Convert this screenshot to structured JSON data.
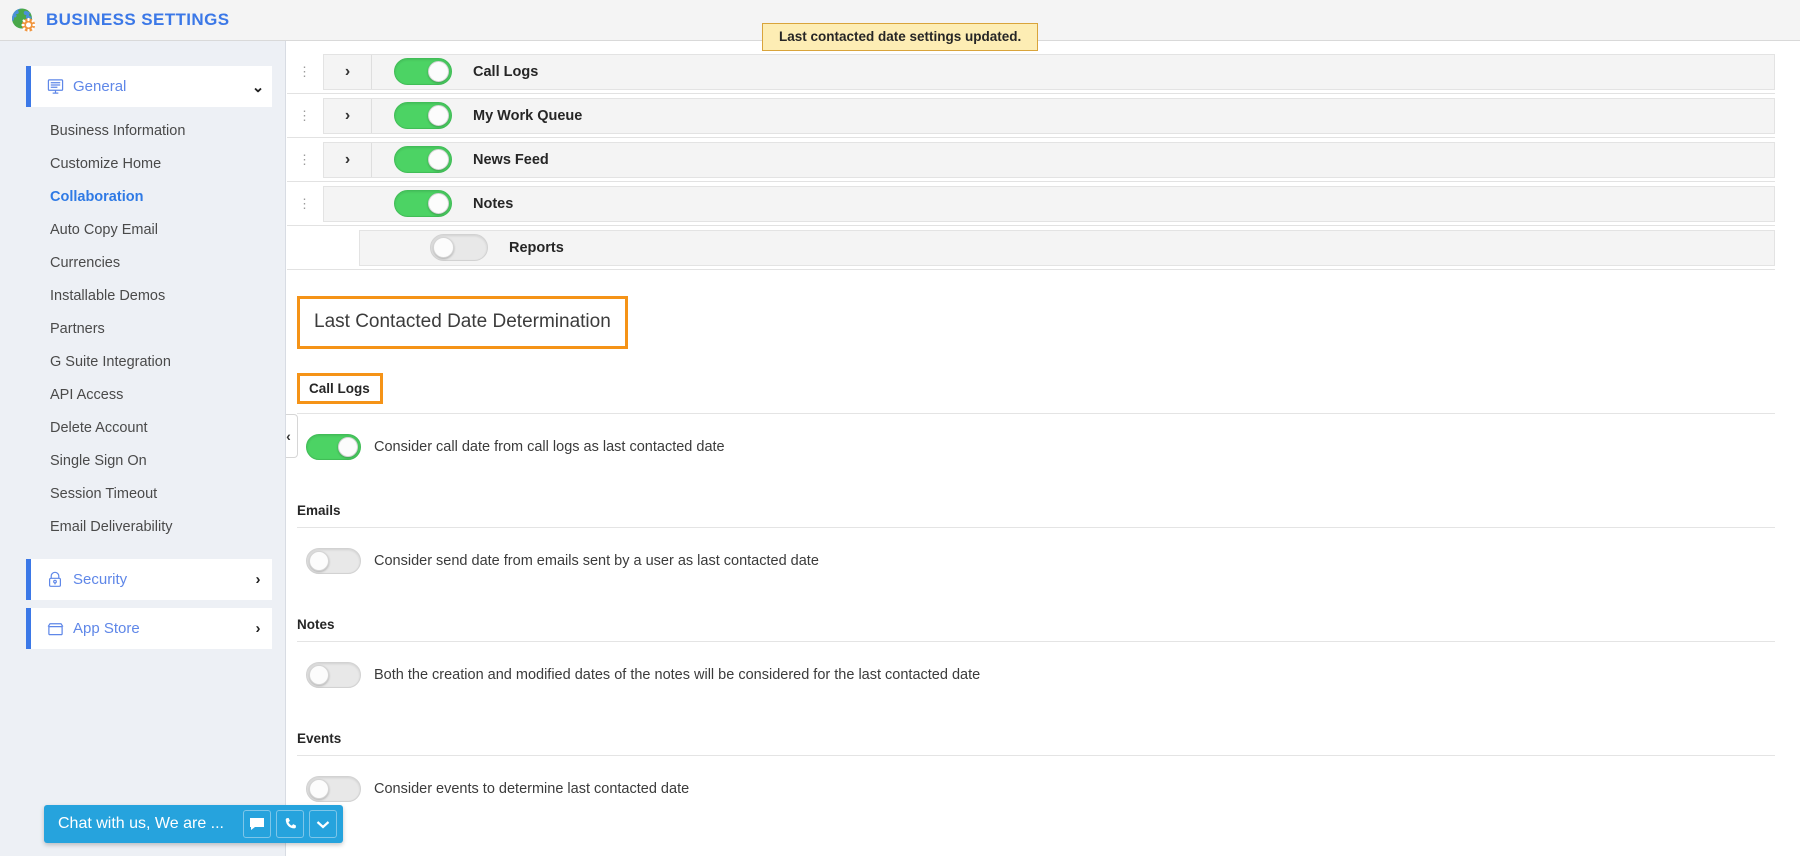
{
  "header": {
    "title": "Business Settings",
    "logo_icon": "globe-gear-icon"
  },
  "toast": {
    "message": "Last contacted date settings updated."
  },
  "sidebar": {
    "groups": [
      {
        "label": "General",
        "icon": "monitor-icon",
        "arrow": "⌄",
        "expanded": true,
        "items": [
          {
            "label": "Business Information",
            "active": false
          },
          {
            "label": "Customize Home",
            "active": false
          },
          {
            "label": "Collaboration",
            "active": true
          },
          {
            "label": "Auto Copy Email",
            "active": false
          },
          {
            "label": "Currencies",
            "active": false
          },
          {
            "label": "Installable Demos",
            "active": false
          },
          {
            "label": "Partners",
            "active": false
          },
          {
            "label": "G Suite Integration",
            "active": false
          },
          {
            "label": "API Access",
            "active": false
          },
          {
            "label": "Delete Account",
            "active": false
          },
          {
            "label": "Single Sign On",
            "active": false
          },
          {
            "label": "Session Timeout",
            "active": false
          },
          {
            "label": "Email Deliverability",
            "active": false
          }
        ]
      },
      {
        "label": "Security",
        "icon": "lock-icon",
        "arrow": "›",
        "expanded": false,
        "items": []
      },
      {
        "label": "App Store",
        "icon": "box-icon",
        "arrow": "›",
        "expanded": false,
        "items": []
      }
    ]
  },
  "main": {
    "module_rows": [
      {
        "label": "Call Logs",
        "enabled": true,
        "expandable": true,
        "draggable": true
      },
      {
        "label": "My Work Queue",
        "enabled": true,
        "expandable": true,
        "draggable": true
      },
      {
        "label": "News Feed",
        "enabled": true,
        "expandable": true,
        "draggable": true
      },
      {
        "label": "Notes",
        "enabled": true,
        "expandable": false,
        "draggable": true
      },
      {
        "label": "Reports",
        "enabled": false,
        "expandable": false,
        "draggable": false
      }
    ],
    "section_title": "Last Contacted Date Determination",
    "subsections": [
      {
        "heading": "Call Logs",
        "highlighted": true,
        "option_label": "Consider call date from call logs as last contacted date",
        "enabled": true
      },
      {
        "heading": "Emails",
        "highlighted": false,
        "option_label": "Consider send date from emails sent by a user as last contacted date",
        "enabled": false
      },
      {
        "heading": "Notes",
        "highlighted": false,
        "option_label": "Both the creation and modified dates of the notes will be considered for the last contacted date",
        "enabled": false
      },
      {
        "heading": "Events",
        "highlighted": false,
        "option_label": "Consider events to determine last contacted date",
        "enabled": false
      }
    ],
    "collapse_tab_icon": "chevron-left-icon"
  },
  "chat": {
    "text": "Chat with us, We are ...",
    "buttons": [
      "chat-bubble-icon",
      "phone-icon",
      "chevron-down-icon"
    ]
  },
  "colors": {
    "accent_blue": "#3b78e7",
    "toggle_on_green": "#4cd364",
    "highlight_orange": "#f59317",
    "toast_bg": "#fdedb4",
    "chat_blue": "#26a3dd"
  }
}
